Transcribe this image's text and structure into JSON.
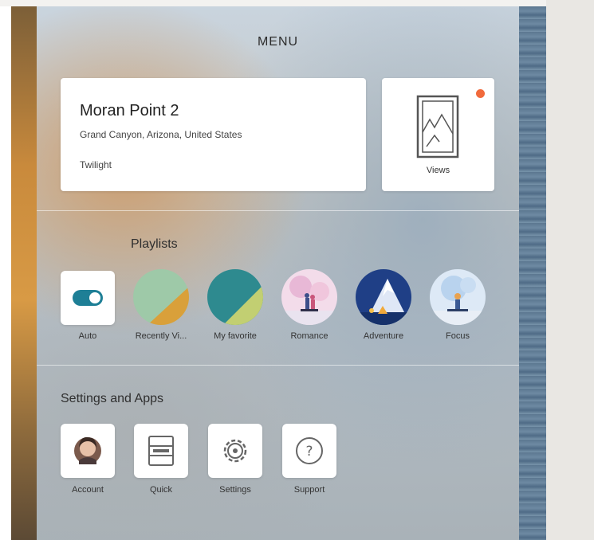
{
  "menu": {
    "title": "MENU"
  },
  "location": {
    "name": "Moran Point 2",
    "place": "Grand Canyon, Arizona, United States",
    "time_of_day": "Twilight"
  },
  "views": {
    "label": "Views",
    "icon": "window-view-icon",
    "has_notification": true
  },
  "playlists": {
    "heading": "Playlists",
    "items": [
      {
        "label": "Auto",
        "icon": "toggle-icon",
        "state": "on"
      },
      {
        "label": "Recently Vi...",
        "icon": "recently-viewed-icon"
      },
      {
        "label": "My favorite",
        "icon": "my-favorite-icon"
      },
      {
        "label": "Romance",
        "icon": "romance-illustration-icon"
      },
      {
        "label": "Adventure",
        "icon": "adventure-illustration-icon"
      },
      {
        "label": "Focus",
        "icon": "focus-illustration-icon"
      }
    ]
  },
  "settings_apps": {
    "heading": "Settings and Apps",
    "items": [
      {
        "label": "Account",
        "icon": "avatar-icon"
      },
      {
        "label": "Quick",
        "icon": "quick-panel-icon"
      },
      {
        "label": "Settings",
        "icon": "gear-icon"
      },
      {
        "label": "Support",
        "icon": "help-icon"
      }
    ]
  },
  "colors": {
    "accent": "#1e7f96",
    "notification": "#f16a3c",
    "card": "#ffffff"
  }
}
